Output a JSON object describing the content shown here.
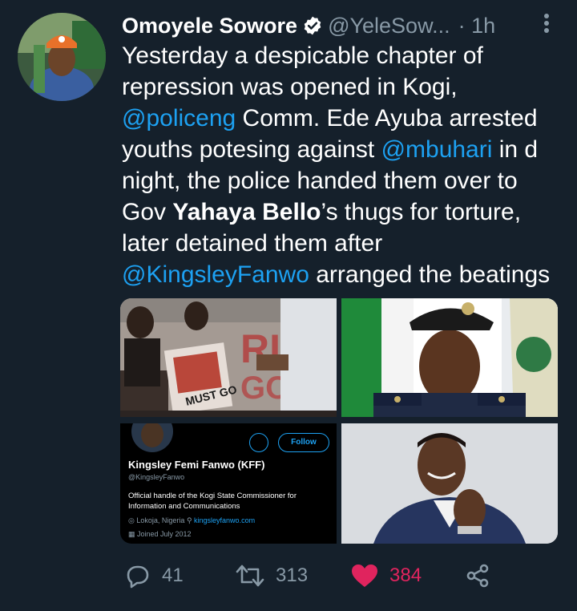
{
  "author": {
    "name": "Omoyele Sowore",
    "handle": "@YeleSow...",
    "time": "· 1h"
  },
  "tweet": {
    "line1": "Yesterday a despicable chapter of",
    "line2": "repression was opened in Kogi,",
    "mention1": "@policeng",
    "line3b": " Comm. Ede Ayuba arrested",
    "line4a": "youths potesing against ",
    "mention2": "@mbuhari",
    "line4b": " in d",
    "line5": "night, the police handed them over to",
    "line6a": "Gov ",
    "bold1": "Yahaya Bello",
    "line6b": "’s thugs for torture,",
    "line7": "later detained them after",
    "mention3": "@KingsleyFanwo",
    "line8b": " arranged the beatings"
  },
  "media": {
    "placard_text": "MUST GO",
    "card": {
      "follow_label": "Follow",
      "name": "Kingsley Femi Fanwo (KFF)",
      "handle": "@KingsleyFanwo",
      "bio": "Official handle of the Kogi State Commissioner for Information and Communications",
      "location": "Lokoja, Nigeria",
      "website": "kingsleyfanwo.com",
      "joined": "Joined July 2012"
    }
  },
  "actions": {
    "replies": "41",
    "retweets": "313",
    "likes": "384"
  },
  "colors": {
    "background": "#15202b",
    "mention": "#1da1f2",
    "like": "#e0245e",
    "muted": "#8899a6"
  }
}
